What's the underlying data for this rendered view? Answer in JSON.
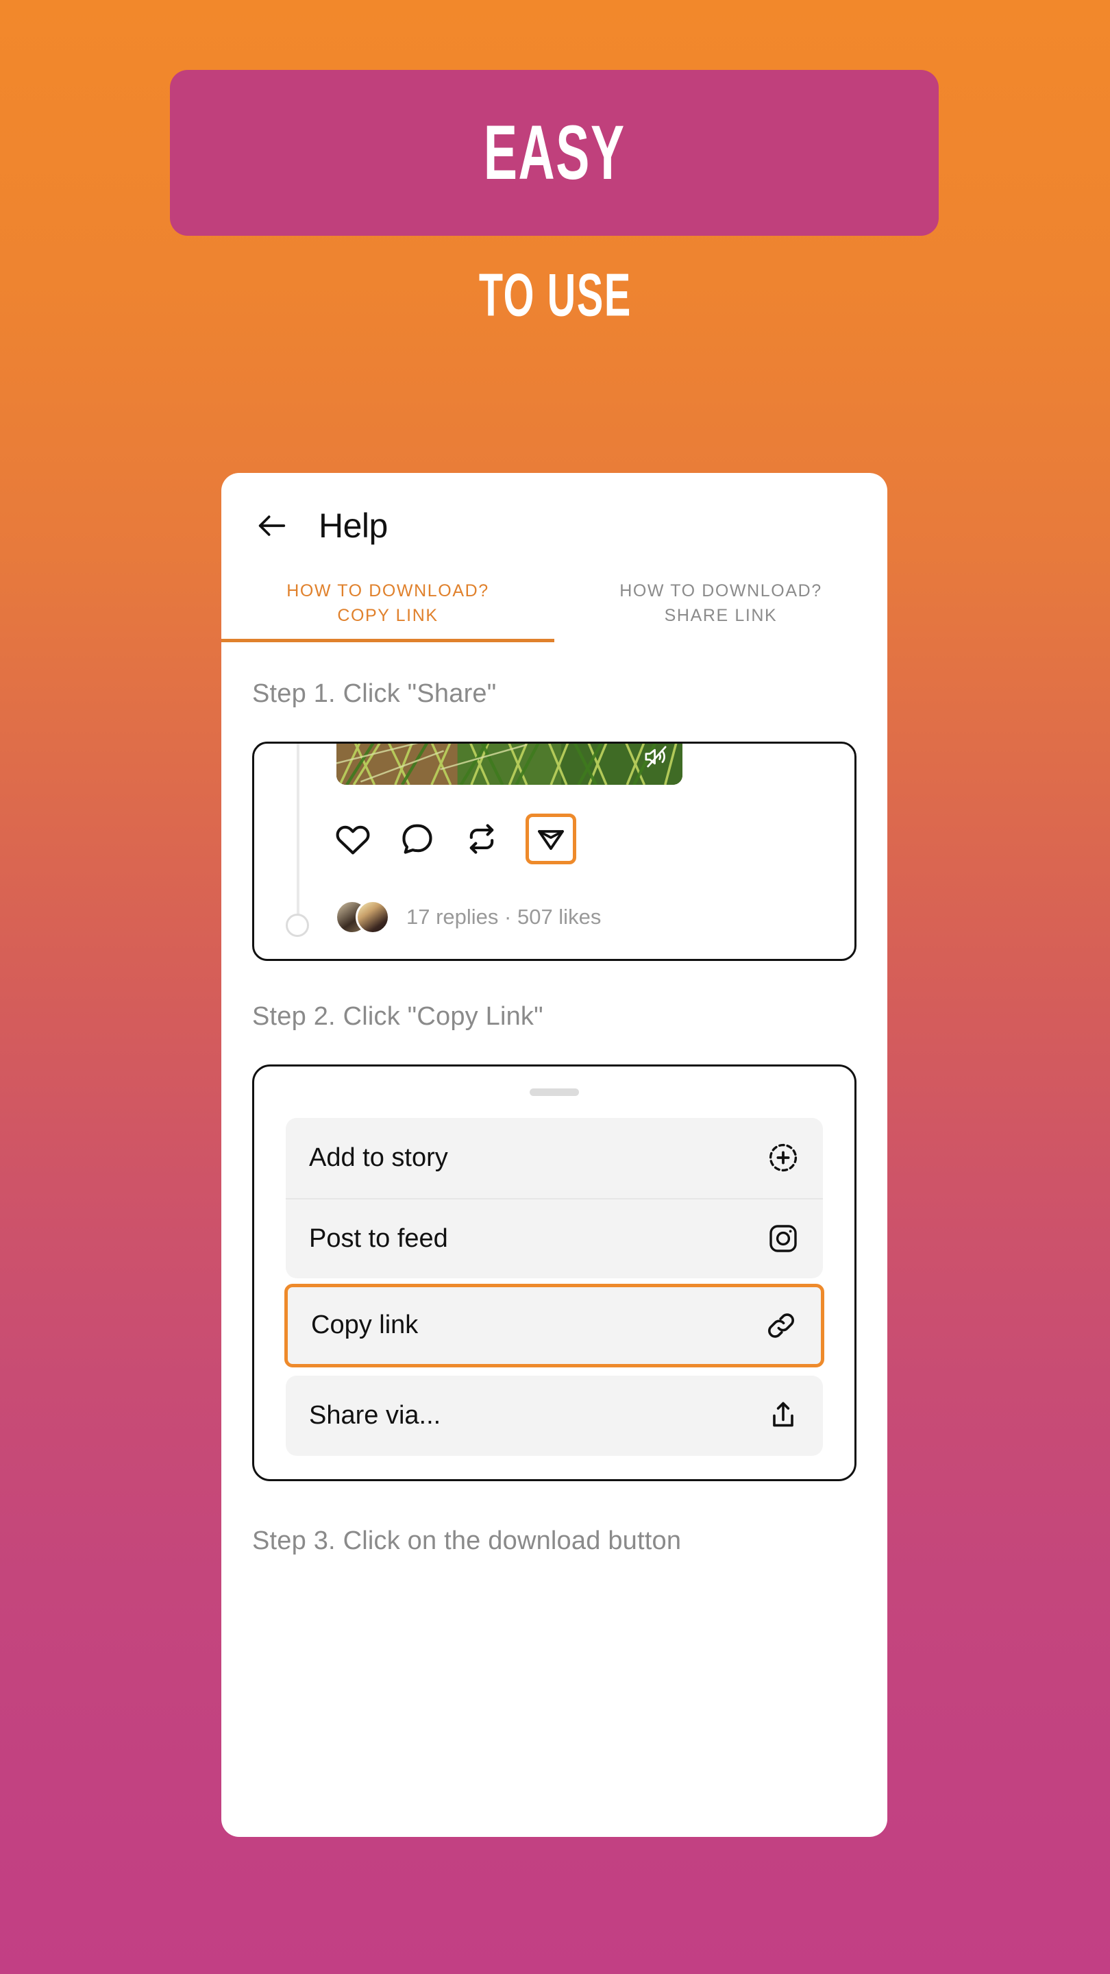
{
  "hero": {
    "banner_text": "EASY",
    "subtitle_text": "TO USE",
    "banner_color": "#C0407C",
    "bg_top_color": "#F2882B",
    "bg_bottom_color": "#C23F84"
  },
  "app": {
    "accent_color": "#E0812C",
    "appbar": {
      "back_icon": "arrow-left-icon",
      "title": "Help"
    },
    "tabs": [
      {
        "line1": "HOW TO DOWNLOAD?",
        "line2": "COPY LINK",
        "active": true
      },
      {
        "line1": "HOW TO DOWNLOAD?",
        "line2": "SHARE LINK",
        "active": false
      }
    ],
    "steps": {
      "step1": "Step 1. Click \"Share\"",
      "step2": "Step 2. Click \"Copy Link\"",
      "step3": "Step 3. Click on the download button"
    },
    "post_preview": {
      "mute_icon": "speaker-muted-icon",
      "actions": [
        {
          "icon": "heart-icon",
          "highlighted": false
        },
        {
          "icon": "comment-icon",
          "highlighted": false
        },
        {
          "icon": "repost-icon",
          "highlighted": false
        },
        {
          "icon": "share-paperplane-icon",
          "highlighted": true
        }
      ],
      "meta_text": "17 replies · 507 likes"
    },
    "share_sheet": {
      "handle": "drag-handle",
      "items": [
        {
          "label": "Add to story",
          "icon": "add-to-story-icon",
          "highlighted": false
        },
        {
          "label": "Post to feed",
          "icon": "instagram-icon",
          "highlighted": false
        },
        {
          "label": "Copy link",
          "icon": "link-icon",
          "highlighted": true
        },
        {
          "label": "Share via...",
          "icon": "share-upload-icon",
          "highlighted": false
        }
      ]
    }
  }
}
